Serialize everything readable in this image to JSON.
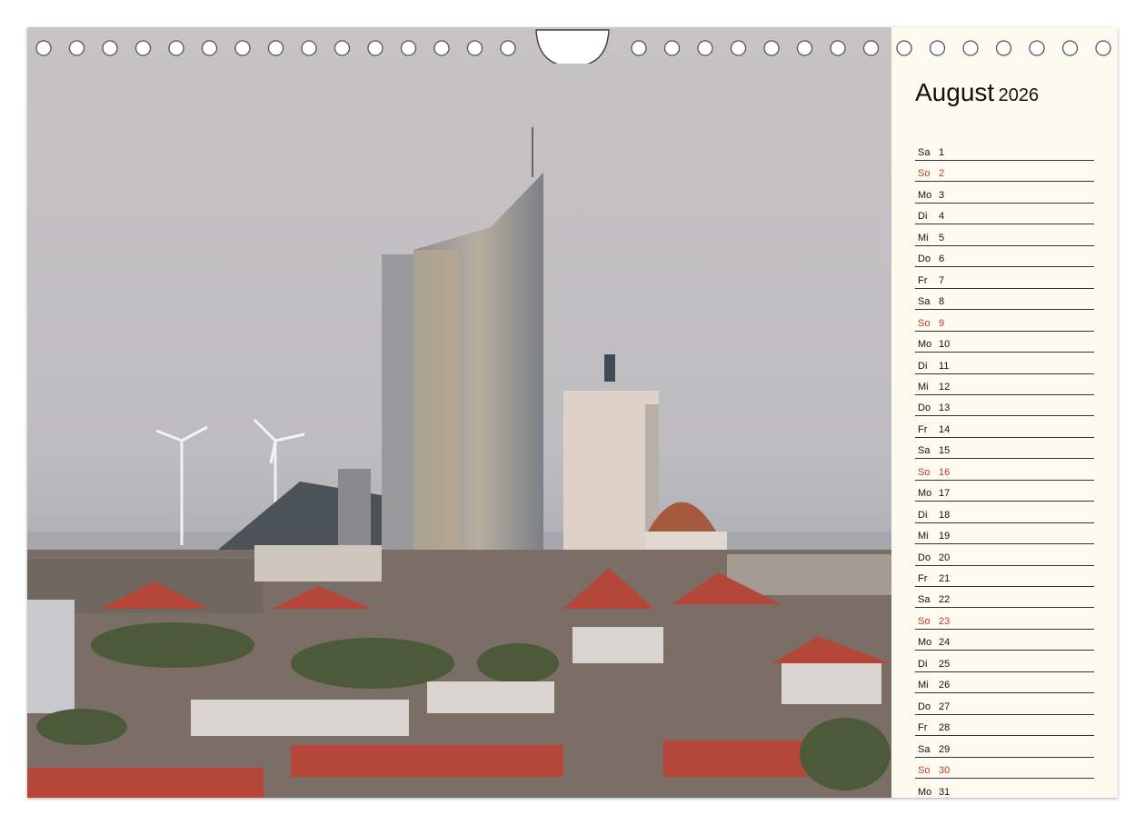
{
  "calendar": {
    "month": "August",
    "year": "2026",
    "days": [
      {
        "wd": "Sa",
        "d": "1"
      },
      {
        "wd": "So",
        "d": "2"
      },
      {
        "wd": "Mo",
        "d": "3"
      },
      {
        "wd": "Di",
        "d": "4"
      },
      {
        "wd": "Mi",
        "d": "5"
      },
      {
        "wd": "Do",
        "d": "6"
      },
      {
        "wd": "Fr",
        "d": "7"
      },
      {
        "wd": "Sa",
        "d": "8"
      },
      {
        "wd": "So",
        "d": "9"
      },
      {
        "wd": "Mo",
        "d": "10"
      },
      {
        "wd": "Di",
        "d": "11"
      },
      {
        "wd": "Mi",
        "d": "12"
      },
      {
        "wd": "Do",
        "d": "13"
      },
      {
        "wd": "Fr",
        "d": "14"
      },
      {
        "wd": "Sa",
        "d": "15"
      },
      {
        "wd": "So",
        "d": "16"
      },
      {
        "wd": "Mo",
        "d": "17"
      },
      {
        "wd": "Di",
        "d": "18"
      },
      {
        "wd": "Mi",
        "d": "19"
      },
      {
        "wd": "Do",
        "d": "20"
      },
      {
        "wd": "Fr",
        "d": "21"
      },
      {
        "wd": "Sa",
        "d": "22"
      },
      {
        "wd": "So",
        "d": "23"
      },
      {
        "wd": "Mo",
        "d": "24"
      },
      {
        "wd": "Di",
        "d": "25"
      },
      {
        "wd": "Mi",
        "d": "26"
      },
      {
        "wd": "Do",
        "d": "27"
      },
      {
        "wd": "Fr",
        "d": "28"
      },
      {
        "wd": "Sa",
        "d": "29"
      },
      {
        "wd": "So",
        "d": "30"
      },
      {
        "wd": "Mo",
        "d": "31"
      }
    ]
  },
  "colors": {
    "sunday": "#c0392b",
    "page": "#fdfbf0",
    "sky": "#c6c3c2"
  },
  "photo": {
    "subject": "city-skyline-photo"
  }
}
